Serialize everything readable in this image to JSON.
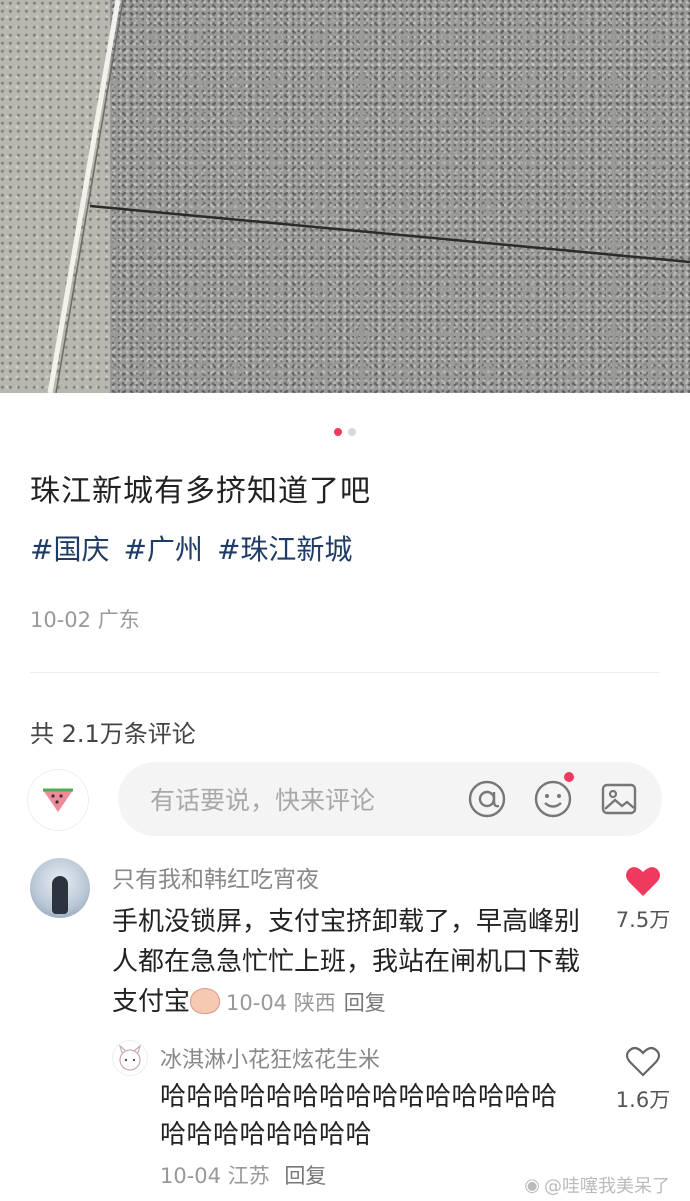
{
  "post": {
    "title": "珠江新城有多挤知道了吧",
    "tags": [
      "#国庆",
      "#广州",
      "#珠江新城"
    ],
    "date_location": "10-02 广东",
    "carousel": {
      "total": 2,
      "active_index": 0
    }
  },
  "comments_section": {
    "count_label": "共 2.1万条评论",
    "input_placeholder": "有话要说，快来评论",
    "icons": [
      "at-icon",
      "emoji-icon",
      "image-icon"
    ],
    "accent": "#ef3a5d"
  },
  "comment": {
    "author": "只有我和韩红吃宵夜",
    "text": "手机没锁屏，支付宝挤卸载了，早高峰别人都在急急忙忙上班，我站在闸机口下载支付宝",
    "time_location": "10-04 陕西",
    "reply_label": "回复",
    "likes": "7.5万",
    "liked": true
  },
  "reply": {
    "author": "冰淇淋小花狂炫花生米",
    "text": "哈哈哈哈哈哈哈哈哈哈哈哈哈哈哈哈哈哈哈哈哈哈哈",
    "time_location": "10-04 江苏",
    "reply_label": "回复",
    "likes": "1.6万",
    "liked": false
  },
  "watermark": "@哇噻我美呆了"
}
